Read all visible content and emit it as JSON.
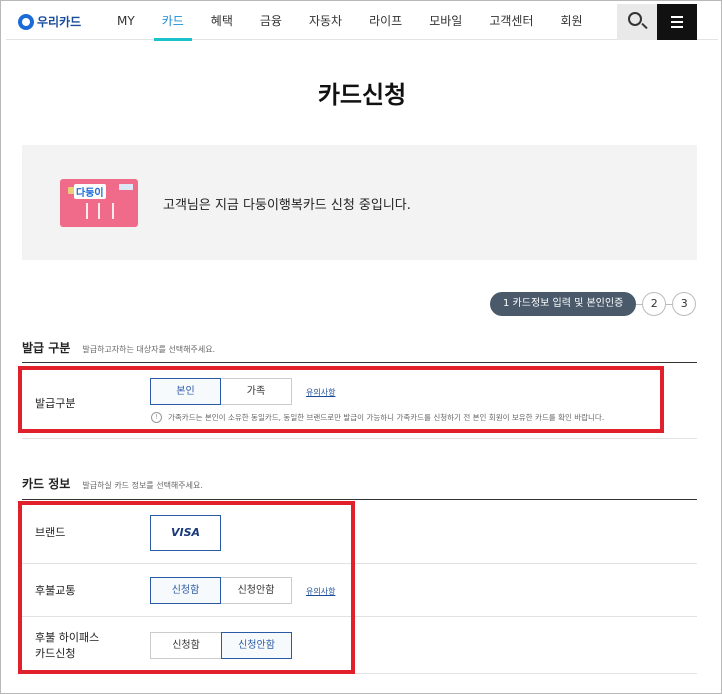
{
  "header": {
    "logo": "우리카드",
    "nav": [
      "MY",
      "카드",
      "혜택",
      "금융",
      "자동차",
      "라이프",
      "모바일",
      "고객센터",
      "회원"
    ],
    "active_nav": "카드"
  },
  "page": {
    "title": "카드신청"
  },
  "card_banner": {
    "card_name": "다둥이",
    "message": "고객님은 지금 다둥이행복카드 신청 중입니다."
  },
  "stepper": {
    "active_step": "1   카드정보 입력 및 본인인증",
    "steps": [
      "2",
      "3"
    ]
  },
  "issue_section": {
    "title": "발급 구분",
    "desc": "발급하고자하는 대상자를 선택해주세요.",
    "row_label": "발급구분",
    "options": [
      "본인",
      "가족"
    ],
    "selected": "본인",
    "note_link": "유의사항",
    "info": "가족카드는 본인이 소유한 동일카드, 동일한 브랜드로만 발급이 가능하니 가족카드를 신청하기 전 본인 회원이 보유한 카드를 확인 바랍니다."
  },
  "card_section": {
    "title": "카드 정보",
    "desc": "발급하실 카드 정보를 선택해주세요.",
    "brand": {
      "label": "브랜드",
      "value": "VISA"
    },
    "transit": {
      "label": "후불교통",
      "options": [
        "신청함",
        "신청안함"
      ],
      "selected": "신청함",
      "note_link": "유의사항"
    },
    "hipass": {
      "label_line1": "후불 하이패스",
      "label_line2": "카드신청",
      "options": [
        "신청함",
        "신청안함"
      ],
      "selected": "신청안함"
    }
  },
  "colors": {
    "accent": "#19c3c9",
    "primary": "#2b5aa5",
    "highlight": "#e0202a"
  }
}
